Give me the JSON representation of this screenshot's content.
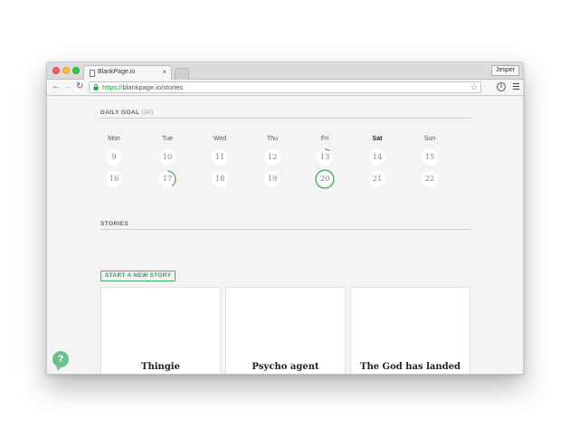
{
  "browser": {
    "tab_title": "BlankPage.io",
    "tab_close": "×",
    "profile_name": "Jesper",
    "url_scheme": "https://",
    "url_rest": "blankpage.io/stories",
    "nav": {
      "back": "←",
      "forward": "→",
      "reload": "↻"
    },
    "star_icon": "☆",
    "info_icon": "i"
  },
  "goal": {
    "heading": "DAILY GOAL",
    "count": "(30)",
    "weekdays": [
      "Mon",
      "Tue",
      "Wed",
      "Thu",
      "Fri",
      "Sat",
      "Sun"
    ],
    "week1": [
      "9",
      "10",
      "11",
      "12",
      "13",
      "14",
      "15"
    ],
    "week2": [
      "16",
      "17",
      "18",
      "19",
      "20",
      "21",
      "22"
    ],
    "progress": {
      "13": 0.1,
      "17": 0.4,
      "20": 1.0
    },
    "accent_color": "#4caf68"
  },
  "stories": {
    "heading": "STORIES",
    "start_label": "START A NEW STORY",
    "cards": [
      "Thingie",
      "Psycho agent",
      "The God has landed"
    ]
  },
  "help_icon": "?"
}
